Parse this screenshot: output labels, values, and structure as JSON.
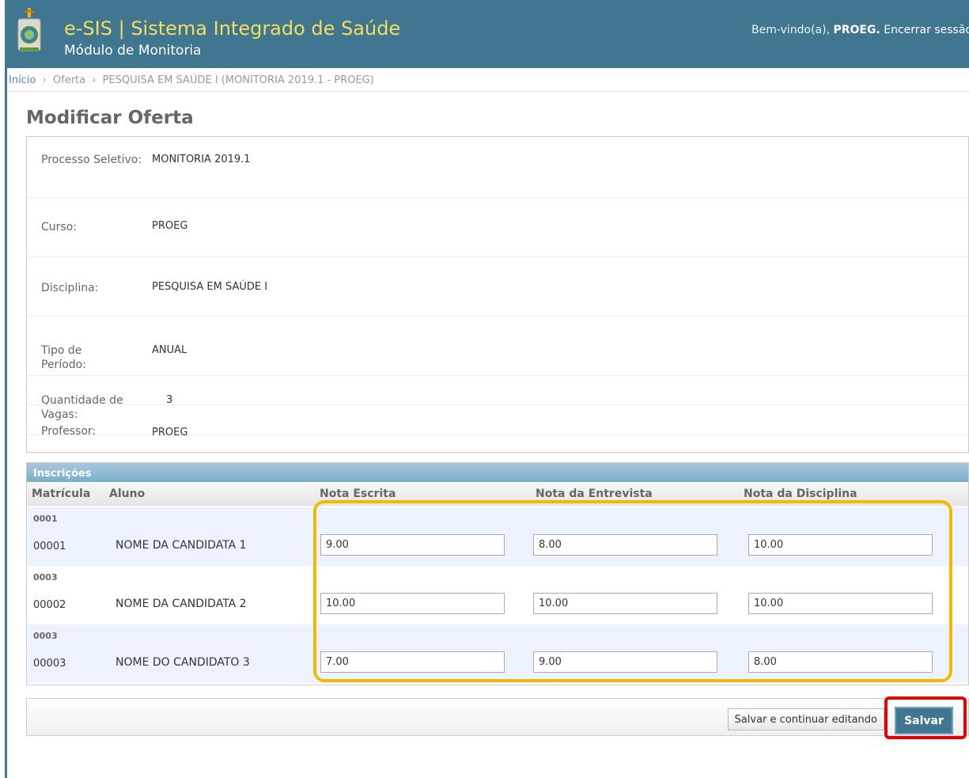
{
  "header": {
    "title": "e-SIS | Sistema Integrado de Saúde",
    "subtitle": "Módulo de Monitoria",
    "welcome_prefix": "Bem-vindo(a), ",
    "user": "PROEG.",
    "logout": "Encerrar sessão"
  },
  "breadcrumb": {
    "home": "Início",
    "separator": "›",
    "section": "Oferta",
    "current": "PESQUISA EM SAÚDE I (MONITORIA 2019.1 - PROEG)"
  },
  "page_title": "Modificar Oferta",
  "fields": [
    {
      "label": "Processo Seletivo:",
      "value": "MONITORIA 2019.1"
    },
    {
      "label": "Curso:",
      "value": "PROEG"
    },
    {
      "label": "Disciplina:",
      "value": "PESQUISA EM SAÚDE I"
    },
    {
      "label": "Tipo de Período:",
      "value": "ANUAL"
    },
    {
      "label": "Quantidade de Vagas:",
      "value": "3"
    },
    {
      "label": "Professor:",
      "value": "PROEG"
    }
  ],
  "inscricoes": {
    "title": "Inscrições",
    "columns": [
      "Matrícula",
      "Aluno",
      "Nota Escrita",
      "Nota da Entrevista",
      "Nota da Disciplina"
    ],
    "rows": [
      {
        "group": "0001",
        "matricula": "00001",
        "aluno": "NOME DA CANDIDATA 1",
        "nota_escrita": "9.00",
        "nota_entrevista": "8.00",
        "nota_disciplina": "10.00"
      },
      {
        "group": "0003",
        "matricula": "00002",
        "aluno": "NOME DA CANDIDATA 2",
        "nota_escrita": "10.00",
        "nota_entrevista": "10.00",
        "nota_disciplina": "10.00"
      },
      {
        "group": "0003",
        "matricula": "00003",
        "aluno": "NOME DO CANDIDATO 3",
        "nota_escrita": "7.00",
        "nota_entrevista": "9.00",
        "nota_disciplina": "8.00"
      }
    ]
  },
  "buttons": {
    "save_continue": "Salvar e continuar editando",
    "save": "Salvar"
  },
  "colors": {
    "header_bg": "#417690",
    "title_yellow": "#f5dd5d",
    "highlight_yellow": "#f5b800",
    "highlight_red": "#e00000"
  }
}
